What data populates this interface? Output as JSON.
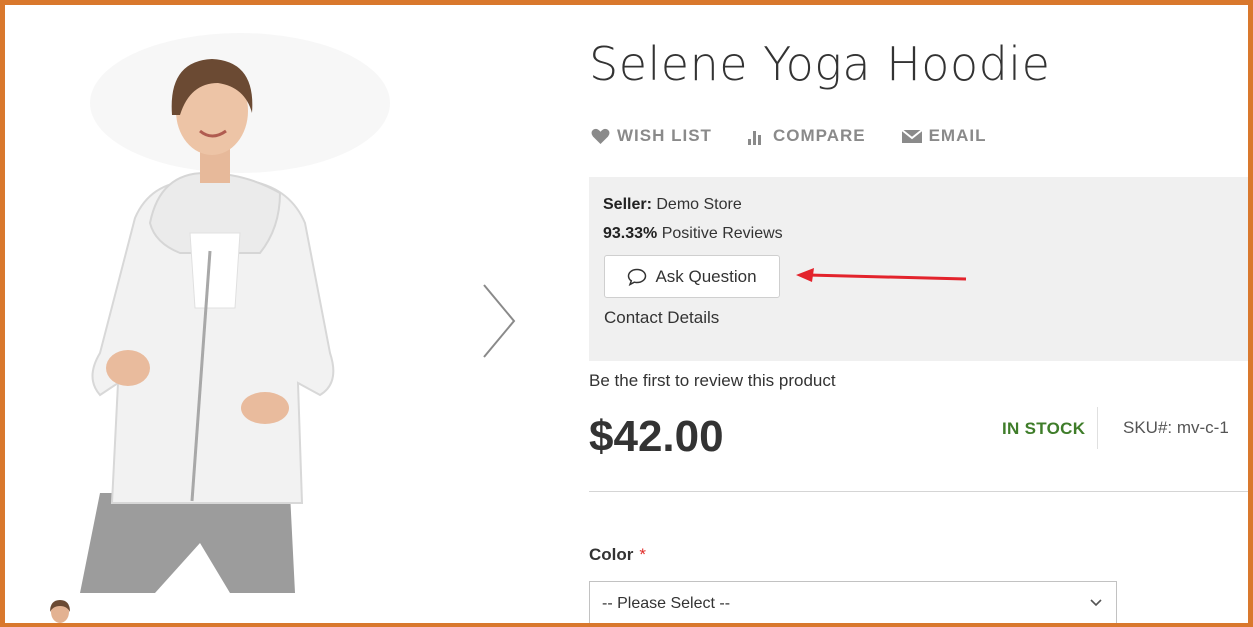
{
  "product": {
    "title": "Selene Yoga Hoodie",
    "price": "$42.00",
    "stock_status": "IN STOCK",
    "sku": "SKU#:  mv-c-1",
    "review_link": "Be the first to review this product"
  },
  "actions": {
    "wishlist": "WISH LIST",
    "compare": "COMPARE",
    "email": "EMAIL"
  },
  "seller": {
    "seller_label": "Seller:",
    "seller_name": "Demo Store",
    "rating_value": "93.33%",
    "rating_text": "Positive Reviews",
    "ask_question": "Ask Question",
    "contact_details": "Contact Details"
  },
  "options": {
    "color_label": "Color",
    "required_mark": "*",
    "color_select_value": "-- Please Select --"
  },
  "icons": {
    "wishlist": "heart-icon",
    "compare": "bar-chart-icon",
    "email": "envelope-icon",
    "ask": "speech-bubble-icon",
    "next": "chevron-right-icon",
    "select": "chevron-down-icon"
  },
  "colors": {
    "frame_border": "#d9782d",
    "in_stock": "#3f7d2a",
    "required": "#e02b27",
    "annotation_arrow": "#e3232c",
    "seller_box_bg": "#f0f0f0"
  }
}
